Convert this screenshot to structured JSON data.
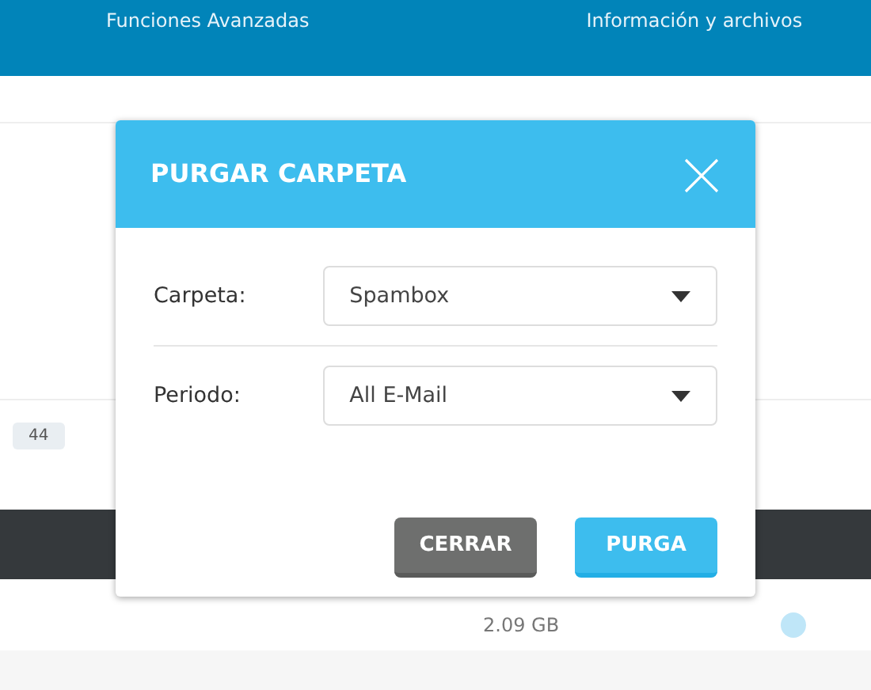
{
  "background": {
    "nav_items": [
      "Funciones Avanzadas",
      "Información y archivos"
    ],
    "filter_badge": "44",
    "rows": [
      {
        "size": "2.09 GB"
      }
    ]
  },
  "dialog": {
    "title": "PURGAR CARPETA",
    "fields": [
      {
        "label": "Carpeta:",
        "value": "Spambox"
      },
      {
        "label": "Periodo:",
        "value": "All E-Mail"
      }
    ],
    "buttons": [
      {
        "label": "CERRAR",
        "kind": "secondary"
      },
      {
        "label": "PURGA",
        "kind": "primary"
      }
    ]
  }
}
